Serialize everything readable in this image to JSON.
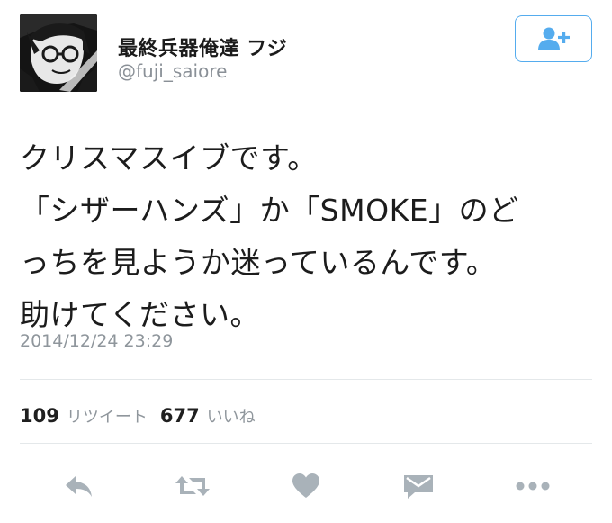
{
  "user": {
    "display_name": "最終兵器俺達 フジ",
    "handle": "@fuji_saiore"
  },
  "tweet": {
    "lines": [
      "クリスマスイブです。",
      "「シザーハンズ」か「SMOKE」のど",
      "っちを見ようか迷っているんです。",
      "助けてください。"
    ],
    "timestamp": "2014/12/24 23:29"
  },
  "stats": {
    "retweet_count": "109",
    "retweet_label": "リツイート",
    "like_count": "677",
    "like_label": "いいね"
  },
  "icons": {
    "follow": "follow-user-icon",
    "reply": "reply-icon",
    "retweet": "retweet-icon",
    "like": "heart-icon",
    "dm": "direct-message-icon",
    "more": "more-dots-icon"
  },
  "colors": {
    "accent": "#55acee",
    "icon_gray": "#a9b2b9",
    "secondary_text": "#8f969c"
  }
}
